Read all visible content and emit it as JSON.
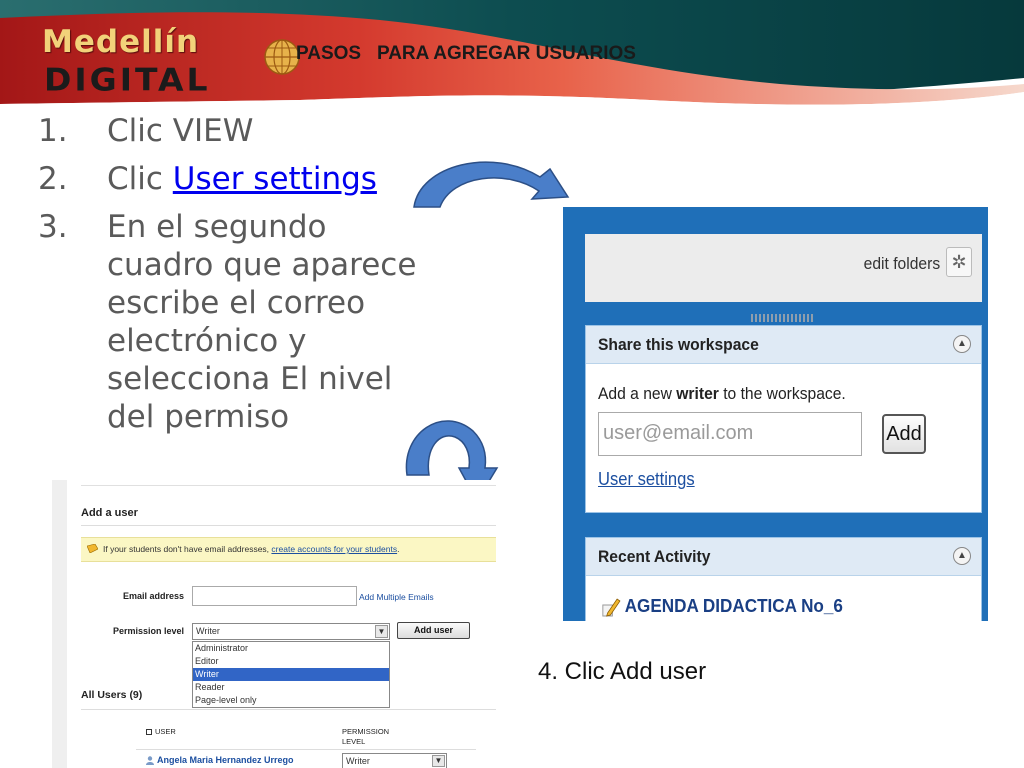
{
  "header": {
    "logo_line1": "Medellín",
    "logo_line2": "DIGITAL",
    "slide_title": "PASOS   PARA AGREGAR USUARIOS",
    "colors": {
      "banner_red": "#c8282a",
      "banner_teal": "#0b4a4d",
      "logo_gold": "#f2d27a"
    }
  },
  "steps": [
    {
      "num": "1.",
      "text": "Clic VIEW"
    },
    {
      "num": "2.",
      "text": "Clic ",
      "link": "User settings"
    },
    {
      "num": "3.",
      "text": "En el segundo cuadro que aparece escribe el correo electrónico y selecciona El nivel del permiso"
    }
  ],
  "workspace": {
    "edit_folders": "edit folders",
    "share_title": "Share this workspace",
    "share_desc_pre": "Add a new ",
    "share_desc_bold": "writer",
    "share_desc_post": " to the workspace.",
    "email_placeholder": "user@email.com",
    "add_button": "Add",
    "user_settings_link": "User settings",
    "recent_title": "Recent Activity",
    "recent_item": "AGENDA DIDACTICA No_6",
    "colors": {
      "sidebar_blue": "#1f6fb8",
      "panel_head": "#dfeaf5"
    }
  },
  "caption": "4. Clic Add user",
  "add_user": {
    "title": "Add a user",
    "notice_text": "If your students don't have email addresses, ",
    "notice_link": "create accounts for your students",
    "notice_end": ".",
    "email_label": "Email address",
    "add_multiple_link": "Add Multiple Emails",
    "permission_label": "Permission level",
    "permission_selected": "Writer",
    "add_user_button": "Add user",
    "permission_options": [
      "Administrator",
      "Editor",
      "Writer",
      "Reader",
      "Page-level only"
    ],
    "selected_option_index": 2,
    "all_users": "All Users (9)",
    "col_user": "USER",
    "col_permission_1": "PERMISSION",
    "col_permission_2": "LEVEL",
    "user_name": "Angela Maria Hernandez Urrego",
    "user_permission": "Writer"
  }
}
